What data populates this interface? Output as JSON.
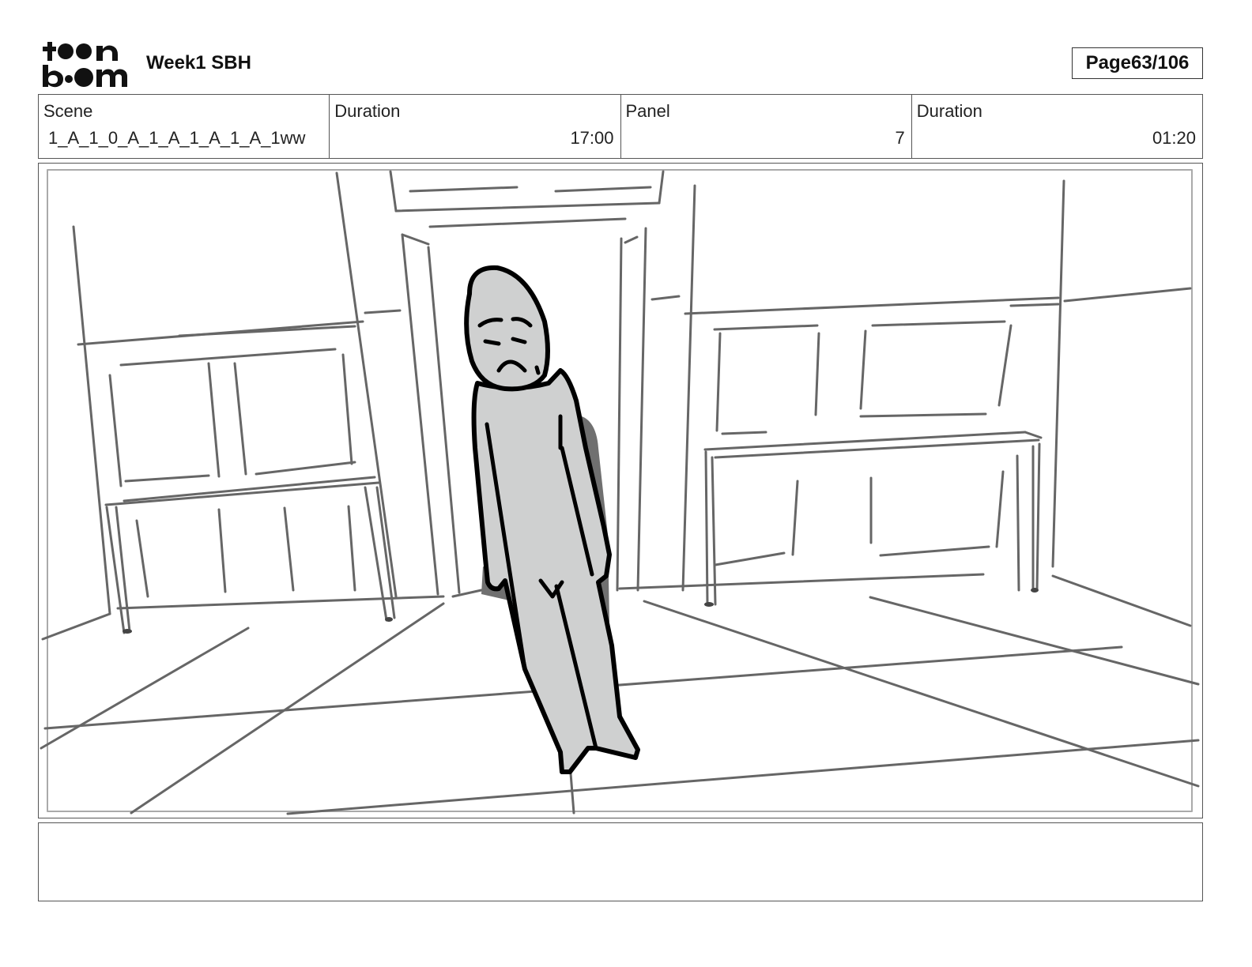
{
  "header": {
    "project_title": "Week1 SBH",
    "page_label": "Page",
    "page_number": "63/106",
    "logo": "toon-boom-logo"
  },
  "info": {
    "scene_label": "Scene",
    "scene_value": "1_A_1_0_A_1_A_1_A_1_A_1ww",
    "duration_label": "Duration",
    "duration_value": "17:00",
    "panel_label": "Panel",
    "panel_value": "7",
    "panel_duration_label": "Duration",
    "panel_duration_value": "01:20"
  },
  "notes": {
    "text": ""
  }
}
